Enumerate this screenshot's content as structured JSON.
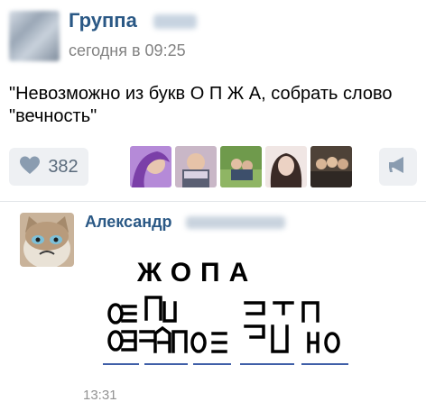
{
  "post": {
    "group_name": "Группа",
    "time": "сегодня в 09:25",
    "text": "\"Невозможно из букв О П Ж А, собрать слово \"вечность\""
  },
  "actions": {
    "like_count": "382",
    "likers_count": 5
  },
  "comment": {
    "author": "Александр",
    "puzzle_word": "ЖОПА",
    "time": "13:31"
  },
  "colors": {
    "link": "#2a5885",
    "muted": "#828282",
    "button_bg": "#eef0f3",
    "icon": "#8a9cb0"
  },
  "icons": {
    "like": "heart-icon",
    "share": "megaphone-icon"
  }
}
